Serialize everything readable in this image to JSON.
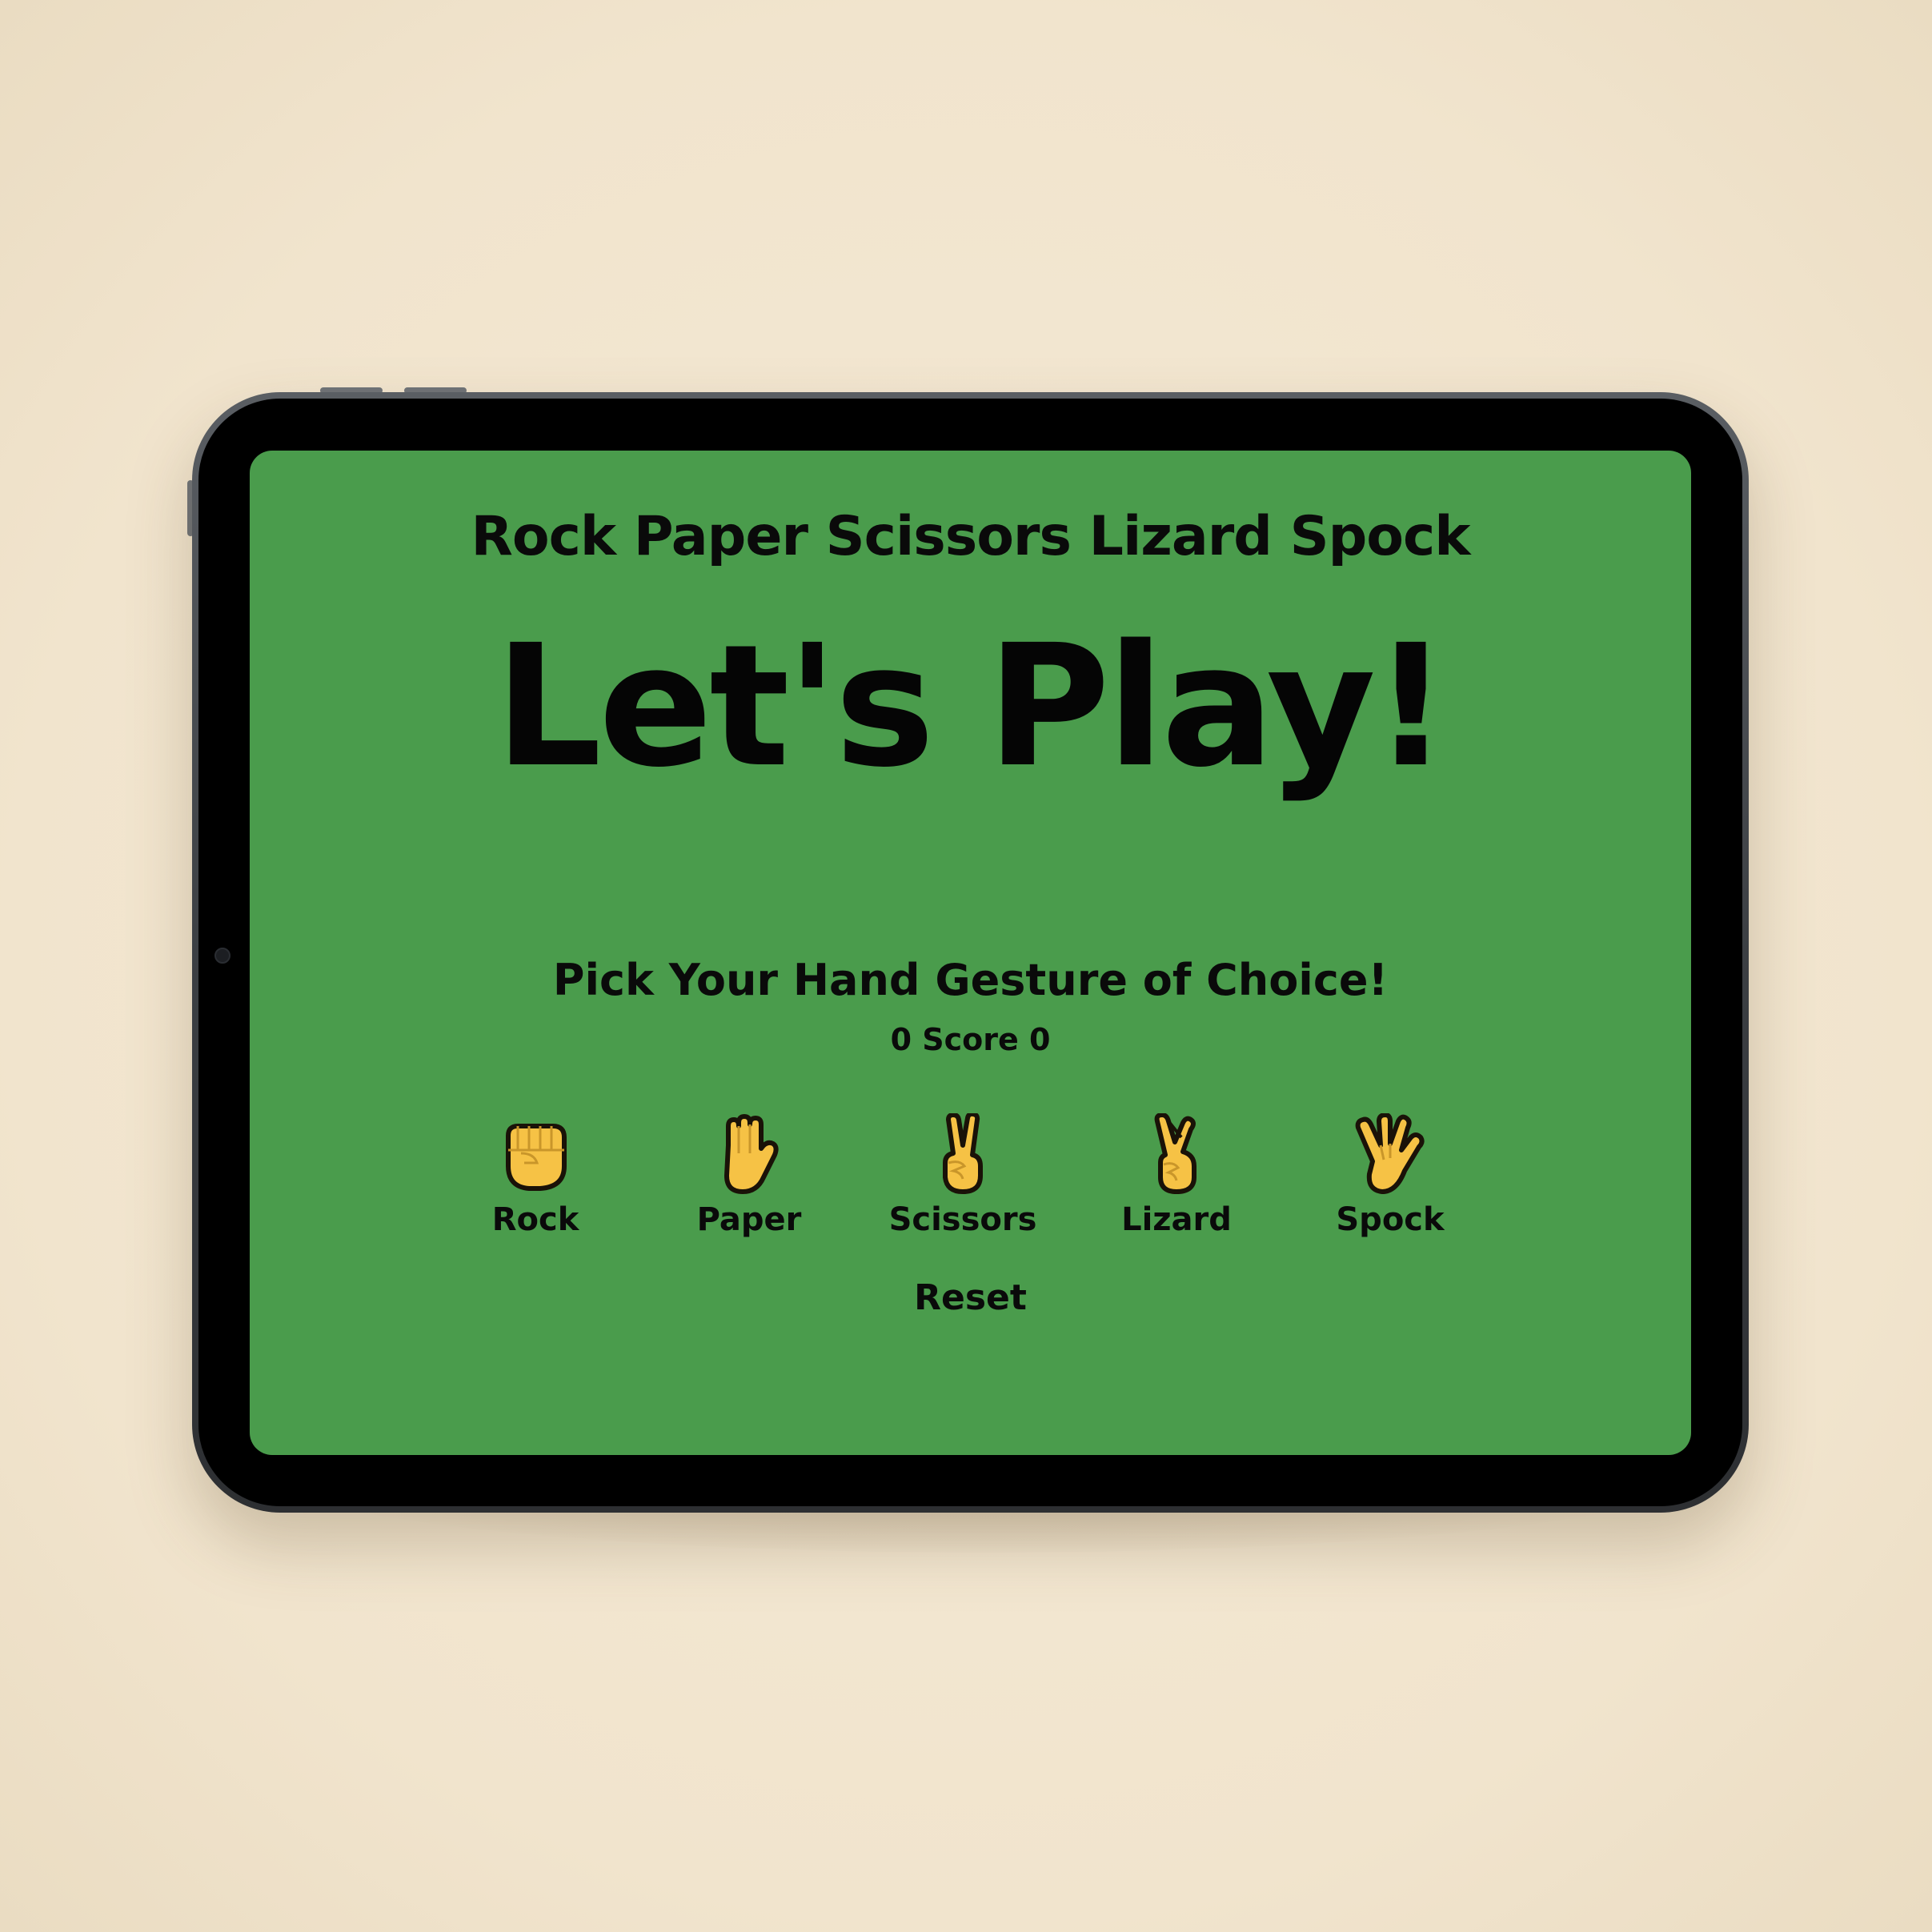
{
  "app": {
    "subtitle": "Rock Paper Scissors Lizard Spock",
    "headline": "Let's Play!",
    "prompt": "Pick Your Hand Gesture of Choice!",
    "score_text": "0 Score 0"
  },
  "choices": [
    {
      "label": "Rock",
      "icon": "raised-fist-icon"
    },
    {
      "label": "Paper",
      "icon": "raised-hand-icon"
    },
    {
      "label": "Scissors",
      "icon": "victory-hand-icon"
    },
    {
      "label": "Lizard",
      "icon": "crossed-fingers-icon"
    },
    {
      "label": "Spock",
      "icon": "vulcan-salute-icon"
    }
  ],
  "controls": {
    "reset_label": "Reset"
  },
  "colors": {
    "background": "#f3e7d1",
    "screen": "#4a9c4c",
    "text": "#0a0a0a",
    "emoji_fill": "#f6c245",
    "emoji_stroke": "#1a1208"
  }
}
